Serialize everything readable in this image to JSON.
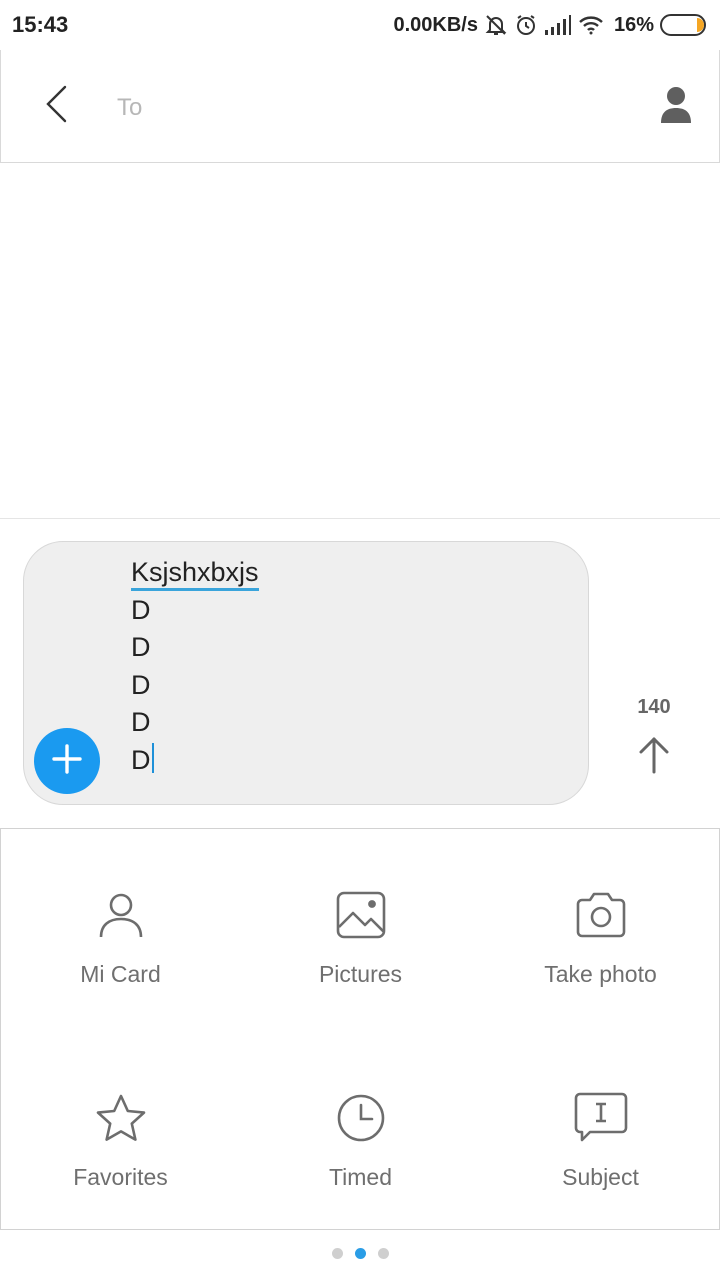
{
  "status_bar": {
    "time": "15:43",
    "net_speed": "0.00KB/s",
    "battery_pct": "16%",
    "icons": [
      "silent-bell-icon",
      "alarm-icon",
      "signal-icon",
      "wifi-icon",
      "battery-icon"
    ]
  },
  "header": {
    "to_placeholder": "To",
    "to_value": "",
    "back_icon": "back-arrow-icon",
    "contact_icon": "contact-icon"
  },
  "compose": {
    "lines": [
      "Ksjshxbxjs",
      "D",
      "D",
      "D",
      "D",
      "D"
    ],
    "char_count": "140",
    "add_icon": "plus-icon",
    "send_icon": "send-arrow-icon"
  },
  "attachments": [
    {
      "label": "Mi Card",
      "icon": "person-card-icon"
    },
    {
      "label": "Pictures",
      "icon": "picture-icon"
    },
    {
      "label": "Take photo",
      "icon": "camera-icon"
    },
    {
      "label": "Favorites",
      "icon": "star-icon"
    },
    {
      "label": "Timed",
      "icon": "clock-icon"
    },
    {
      "label": "Subject",
      "icon": "subject-icon"
    }
  ],
  "pager": {
    "pages": 3,
    "active_index": 1
  },
  "colors": {
    "accent": "#1a9af0",
    "underline": "#3aa4db",
    "caret": "#1e90d8",
    "battery_low": "#f5a623"
  }
}
